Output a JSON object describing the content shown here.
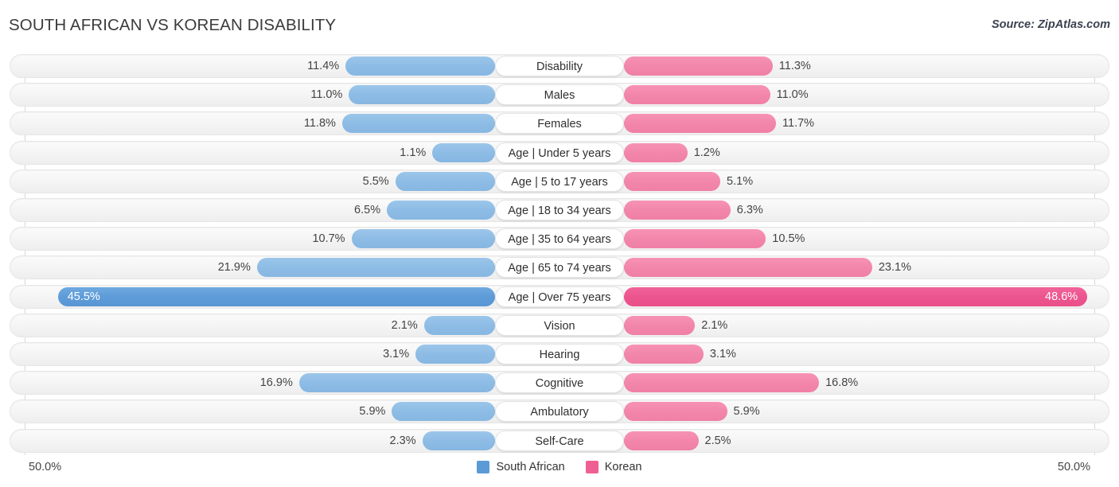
{
  "header": {
    "title": "SOUTH AFRICAN VS KOREAN DISABILITY",
    "source": "Source: ZipAtlas.com"
  },
  "footer": {
    "axis_left": "50.0%",
    "axis_right": "50.0%",
    "legend": [
      {
        "label": "South African",
        "color": "#5b9bd5"
      },
      {
        "label": "Korean",
        "color": "#ef5f94"
      }
    ]
  },
  "chart_data": {
    "type": "bar",
    "title": "SOUTH AFRICAN VS KOREAN DISABILITY",
    "subtitle": "Source: ZipAtlas.com",
    "orientation": "horizontal-diverging",
    "xlabel": "",
    "ylabel": "",
    "xlim": [
      -50.0,
      50.0
    ],
    "axis_tick_labels": [
      "50.0%",
      "50.0%"
    ],
    "grid": true,
    "legend_position": "bottom-center",
    "categories": [
      "Disability",
      "Males",
      "Females",
      "Age | Under 5 years",
      "Age | 5 to 17 years",
      "Age | 18 to 34 years",
      "Age | 35 to 64 years",
      "Age | 65 to 74 years",
      "Age | Over 75 years",
      "Vision",
      "Hearing",
      "Cognitive",
      "Ambulatory",
      "Self-Care"
    ],
    "series": [
      {
        "name": "South African",
        "color": "#8dbce5",
        "highlight_color": "#5e9cd9",
        "values": [
          11.4,
          11.0,
          11.8,
          1.1,
          5.5,
          6.5,
          10.7,
          21.9,
          45.5,
          2.1,
          3.1,
          16.9,
          5.9,
          2.3
        ],
        "labels": [
          "11.4%",
          "11.0%",
          "11.8%",
          "1.1%",
          "5.5%",
          "6.5%",
          "10.7%",
          "21.9%",
          "45.5%",
          "2.1%",
          "3.1%",
          "16.9%",
          "5.9%",
          "2.3%"
        ]
      },
      {
        "name": "Korean",
        "color": "#f286ab",
        "highlight_color": "#ec558f",
        "values": [
          11.3,
          11.0,
          11.7,
          1.2,
          5.1,
          6.3,
          10.5,
          23.1,
          48.6,
          2.1,
          3.1,
          16.8,
          5.9,
          2.5
        ],
        "labels": [
          "11.3%",
          "11.0%",
          "11.7%",
          "1.2%",
          "5.1%",
          "6.3%",
          "10.5%",
          "23.1%",
          "48.6%",
          "2.1%",
          "3.1%",
          "16.8%",
          "5.9%",
          "2.5%"
        ]
      }
    ],
    "max_row_index": 8
  }
}
